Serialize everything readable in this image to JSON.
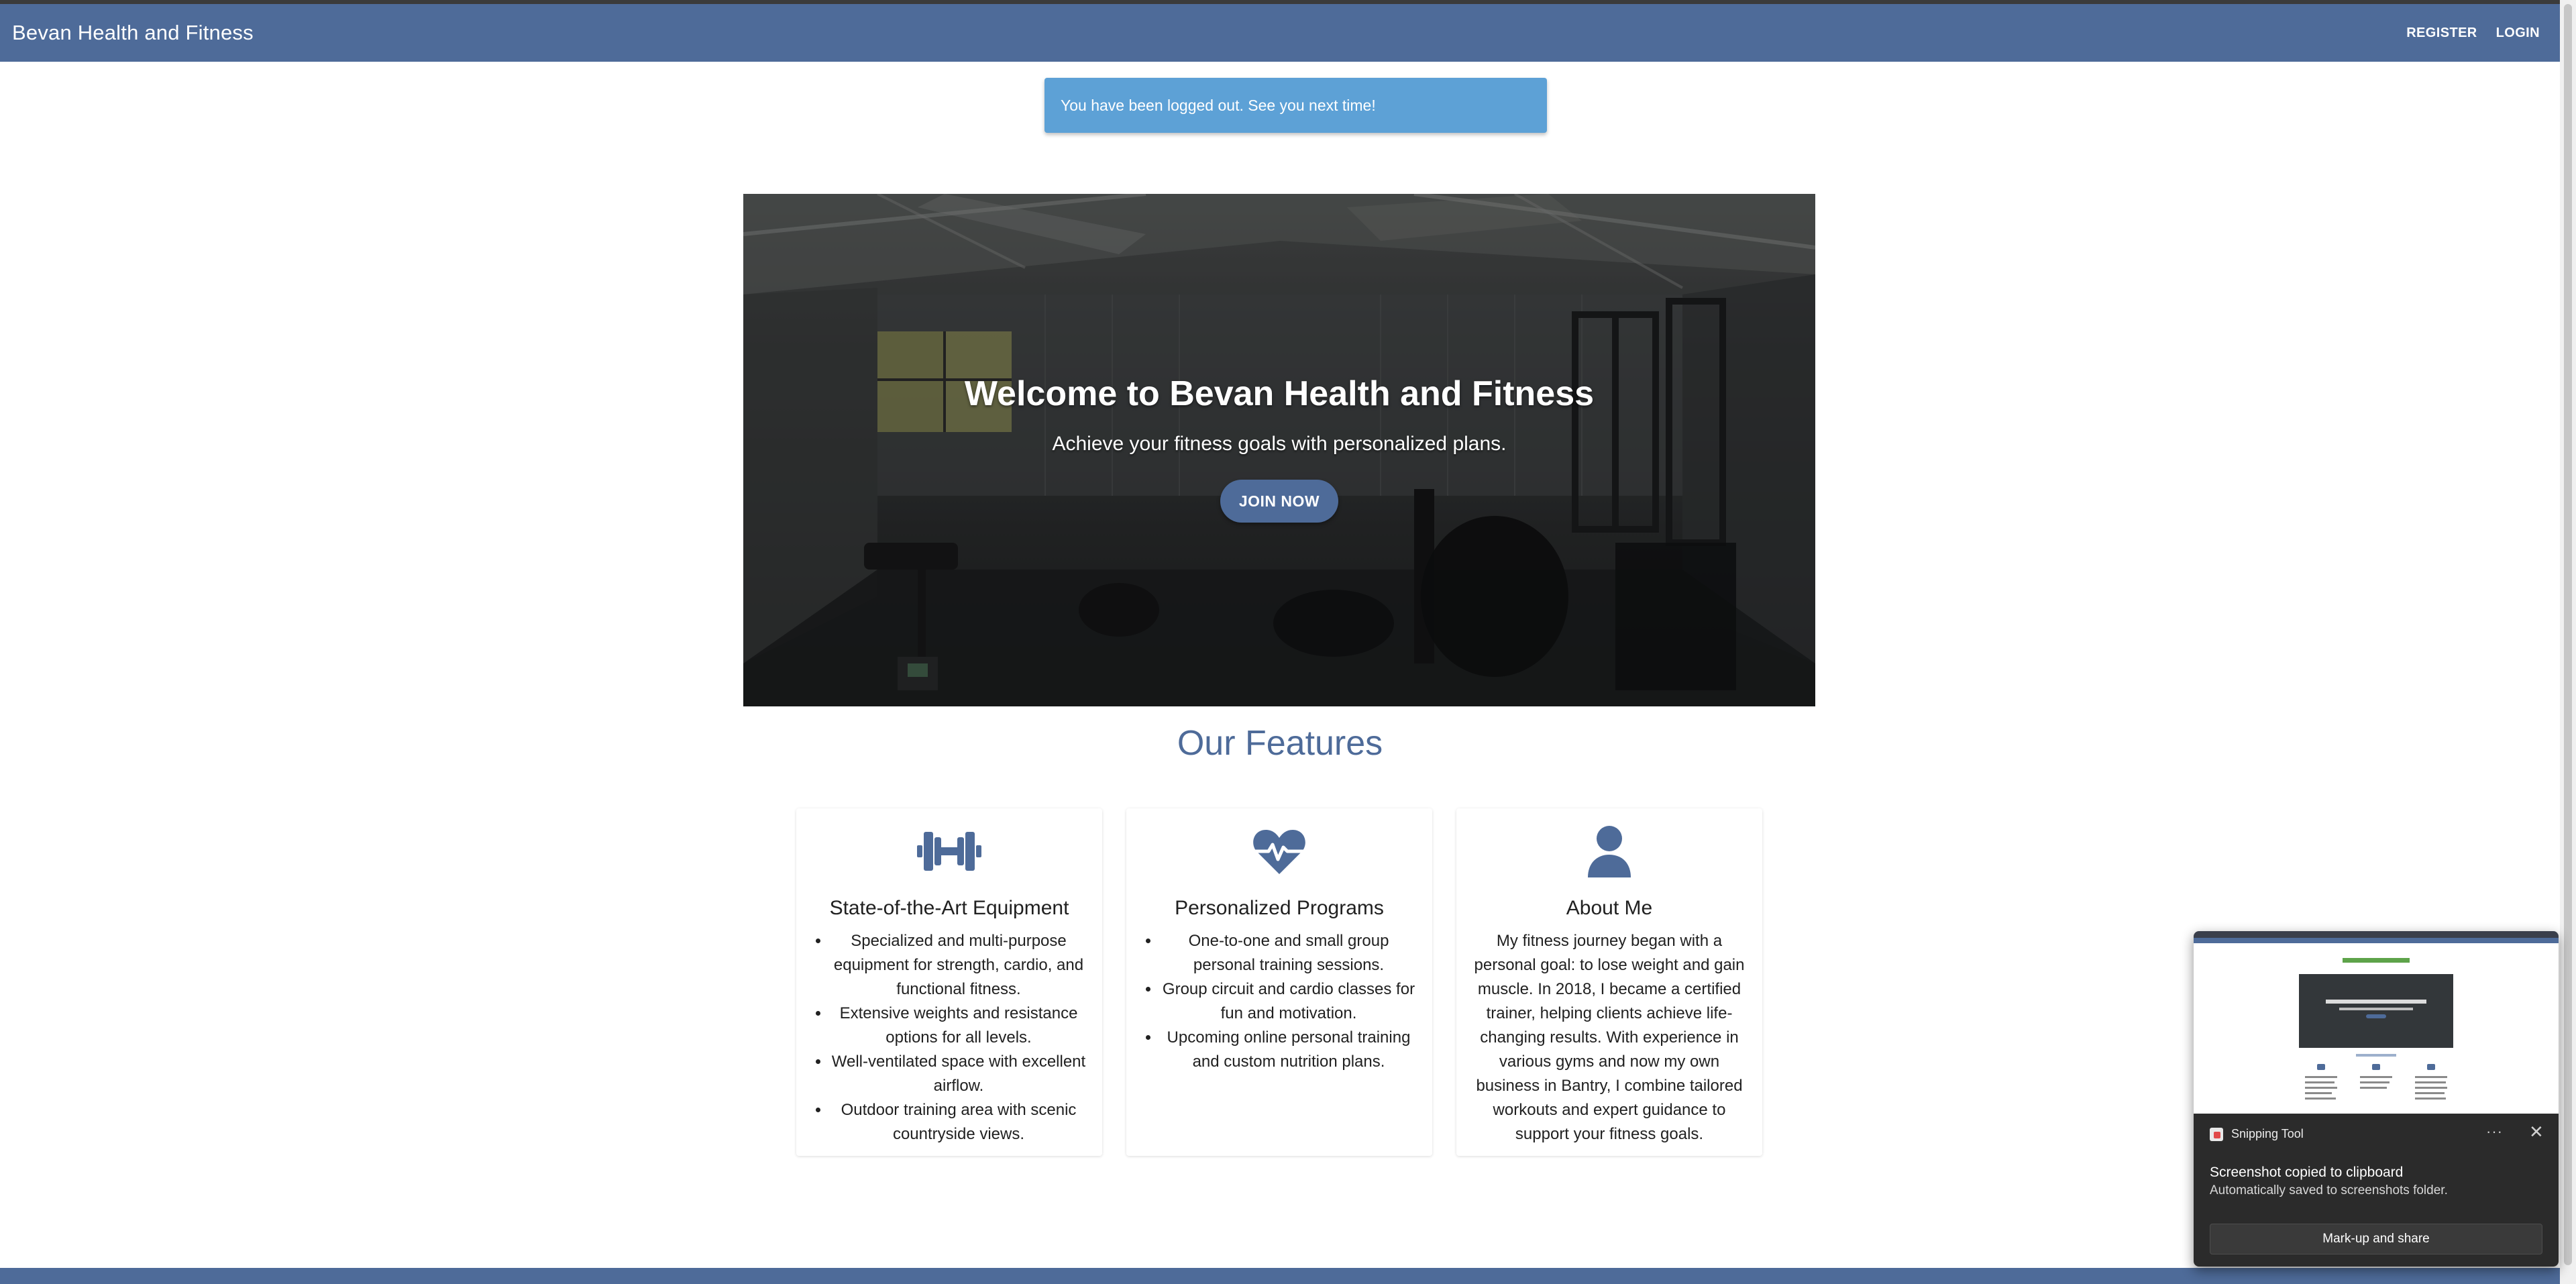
{
  "navbar": {
    "brand": "Bevan Health and Fitness",
    "links": [
      "REGISTER",
      "LOGIN"
    ]
  },
  "flash": {
    "message": "You have been logged out. See you next time!"
  },
  "hero": {
    "title": "Welcome to Bevan Health and Fitness",
    "subtitle": "Achieve your fitness goals with personalized plans.",
    "button_label": "JOIN NOW"
  },
  "features": {
    "heading": "Our Features",
    "cards": [
      {
        "icon": "dumbbell-icon",
        "title": "State-of-the-Art Equipment",
        "items": [
          "Specialized and multi-purpose equipment for strength, cardio, and functional fitness.",
          "Extensive weights and resistance options for all levels.",
          "Well-ventilated space with excellent airflow.",
          "Outdoor training area with scenic countryside views."
        ]
      },
      {
        "icon": "heart-pulse-icon",
        "title": "Personalized Programs",
        "items": [
          "One-to-one and small group personal training sessions.",
          "Group circuit and cardio classes for fun and motivation.",
          "Upcoming online personal training and custom nutrition plans."
        ]
      },
      {
        "icon": "user-icon",
        "title": "About Me",
        "text": "My fitness journey began with a personal goal: to lose weight and gain muscle. In 2018, I became a certified trainer, helping clients achieve life-changing results. With experience in various gyms and now my own business in Bantry, I combine tailored workouts and expert guidance to support your fitness goals."
      }
    ]
  },
  "toast": {
    "app_name": "Snipping Tool",
    "more_label": "···",
    "close_label": "✕",
    "title": "Screenshot copied to clipboard",
    "text": "Automatically saved to screenshots folder.",
    "button_label": "Mark-up and share"
  },
  "colors": {
    "primary": "#4e6b99",
    "flash": "#5da1d6",
    "toast_bg": "#2b2b2b"
  }
}
